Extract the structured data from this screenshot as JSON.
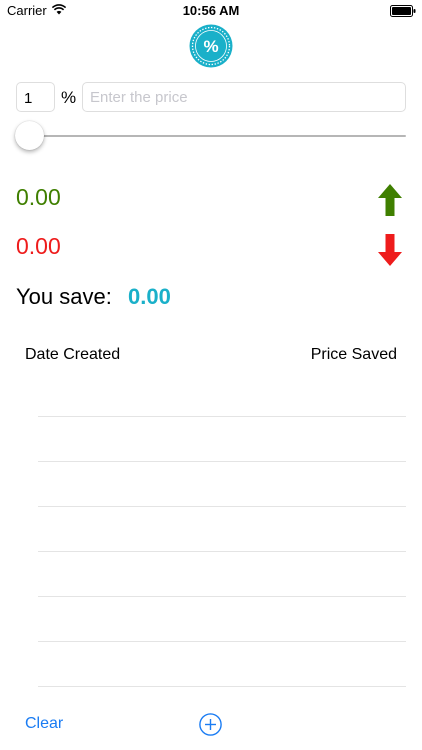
{
  "status_bar": {
    "carrier": "Carrier",
    "time": "10:56 AM"
  },
  "form": {
    "percent_value": "1",
    "percent_symbol": "%",
    "price_placeholder": "Enter the price"
  },
  "slider": {
    "value_fraction": 0.0
  },
  "results": {
    "increased_value": "0.00",
    "decreased_value": "0.00"
  },
  "savings": {
    "label": "You save:",
    "value": "0.00"
  },
  "table": {
    "headers": {
      "date": "Date Created",
      "price": "Price Saved"
    },
    "rows": []
  },
  "toolbar": {
    "clear_label": "Clear"
  },
  "icons": {
    "logo": "percent-badge-icon",
    "up": "arrow-up-icon",
    "down": "arrow-down-icon",
    "add": "plus-circle-icon"
  },
  "colors": {
    "accent": "#1a7cf3",
    "teal": "#1ab0c9",
    "increase": "#3f7f00",
    "decrease": "#ee1c1c"
  }
}
